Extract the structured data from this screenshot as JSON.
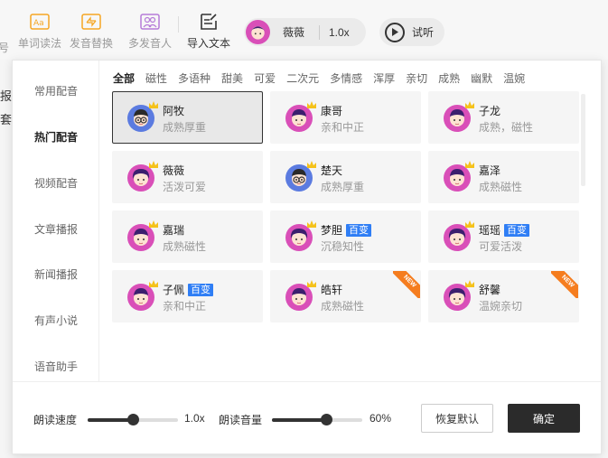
{
  "toolbar": {
    "items": [
      {
        "label": "号"
      },
      {
        "label": "单词读法"
      },
      {
        "label": "发音替换"
      },
      {
        "label": "多发音人"
      },
      {
        "label": "导入文本"
      }
    ],
    "voice": {
      "name": "薇薇",
      "speed": "1.0x"
    },
    "listen_label": "试听"
  },
  "background_text": [
    "报",
    "套"
  ],
  "sidebar": {
    "items": [
      {
        "label": "常用配音"
      },
      {
        "label": "热门配音",
        "active": true
      },
      {
        "label": "视频配音"
      },
      {
        "label": "文章播报"
      },
      {
        "label": "新闻播报"
      },
      {
        "label": "有声小说"
      },
      {
        "label": "语音助手"
      }
    ]
  },
  "tags": [
    "全部",
    "磁性",
    "多语种",
    "甜美",
    "可爱",
    "二次元",
    "多情感",
    "浑厚",
    "亲切",
    "成熟",
    "幽默",
    "温婉"
  ],
  "voices": [
    {
      "name": "阿牧",
      "desc": "成熟厚重",
      "badge": "",
      "new": false,
      "selected": true,
      "avatar": "male-glasses"
    },
    {
      "name": "康哥",
      "desc": "亲和中正",
      "badge": "",
      "new": false,
      "selected": false,
      "avatar": "male"
    },
    {
      "name": "子龙",
      "desc": "成熟，磁性",
      "badge": "",
      "new": false,
      "selected": false,
      "avatar": "male"
    },
    {
      "name": "薇薇",
      "desc": "活泼可爱",
      "badge": "",
      "new": false,
      "selected": false,
      "avatar": "female"
    },
    {
      "name": "楚天",
      "desc": "成熟厚重",
      "badge": "",
      "new": false,
      "selected": false,
      "avatar": "male-glasses"
    },
    {
      "name": "嘉泽",
      "desc": "成熟磁性",
      "badge": "",
      "new": false,
      "selected": false,
      "avatar": "male"
    },
    {
      "name": "嘉瑞",
      "desc": "成熟磁性",
      "badge": "",
      "new": false,
      "selected": false,
      "avatar": "male"
    },
    {
      "name": "梦胆",
      "desc": "沉稳知性",
      "badge": "百变",
      "new": false,
      "selected": false,
      "avatar": "female"
    },
    {
      "name": "瑶瑶",
      "desc": "可爱活泼",
      "badge": "百变",
      "new": false,
      "selected": false,
      "avatar": "female"
    },
    {
      "name": "子佩",
      "desc": "亲和中正",
      "badge": "百变",
      "new": false,
      "selected": false,
      "avatar": "male"
    },
    {
      "name": "皓轩",
      "desc": "成熟磁性",
      "badge": "",
      "new": true,
      "selected": false,
      "avatar": "male"
    },
    {
      "name": "舒馨",
      "desc": "温婉亲切",
      "badge": "",
      "new": true,
      "selected": false,
      "avatar": "female"
    }
  ],
  "new_label": "NEW",
  "settings": {
    "speed_label": "朗读速度",
    "speed_value": "1.0x",
    "speed_fraction": 0.5,
    "volume_label": "朗读音量",
    "volume_value": "60%",
    "volume_fraction": 0.6,
    "reset_label": "恢复默认",
    "confirm_label": "确定"
  },
  "colors": {
    "accent": "#2b2b2b",
    "badge": "#2f7ef5",
    "new_ribbon": "#f57d1f",
    "icon_orange": "#f5a623",
    "icon_purple": "#b57bd8",
    "avatar_pink": "#d94fb8"
  }
}
